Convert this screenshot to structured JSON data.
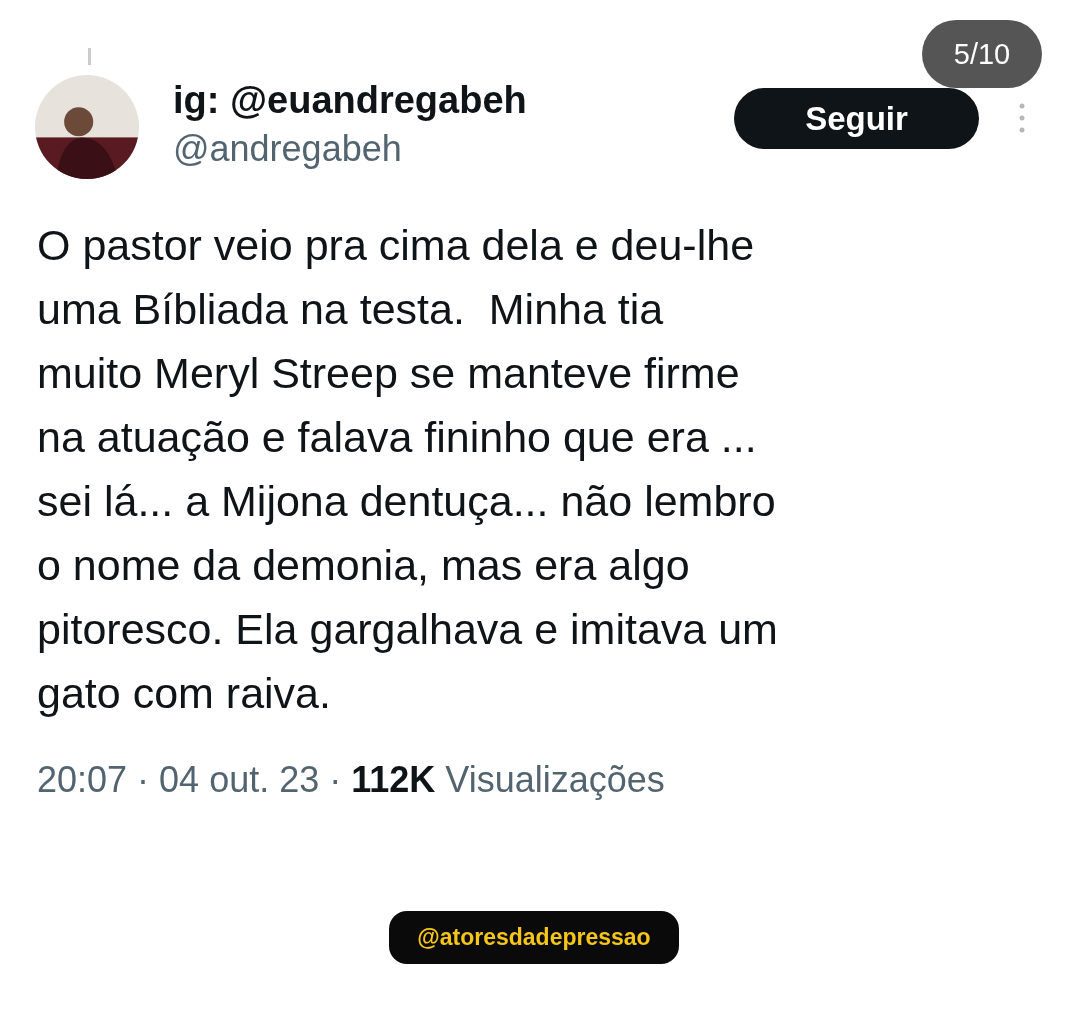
{
  "counter": "5/10",
  "tweet": {
    "display_name": "ig: @euandregabeh",
    "handle": "@andregabeh",
    "follow_button": "Seguir",
    "text": "O pastor veio pra cima dela e deu-lhe\numa Bíbliada na testa.  Minha tia\nmuito Meryl Streep se manteve firme\nna atuação e falava fininho que era ...\nsei lá... a Mijona dentuça... não lembro\no nome da demonia, mas era algo\npitoresco. Ela gargalhava e imitava um\ngato com raiva.",
    "time": "20:07 · 04 out. 23 ·",
    "views_count": "112K",
    "views_label": "Visualizações"
  },
  "credit": "@atoresdadepressao"
}
